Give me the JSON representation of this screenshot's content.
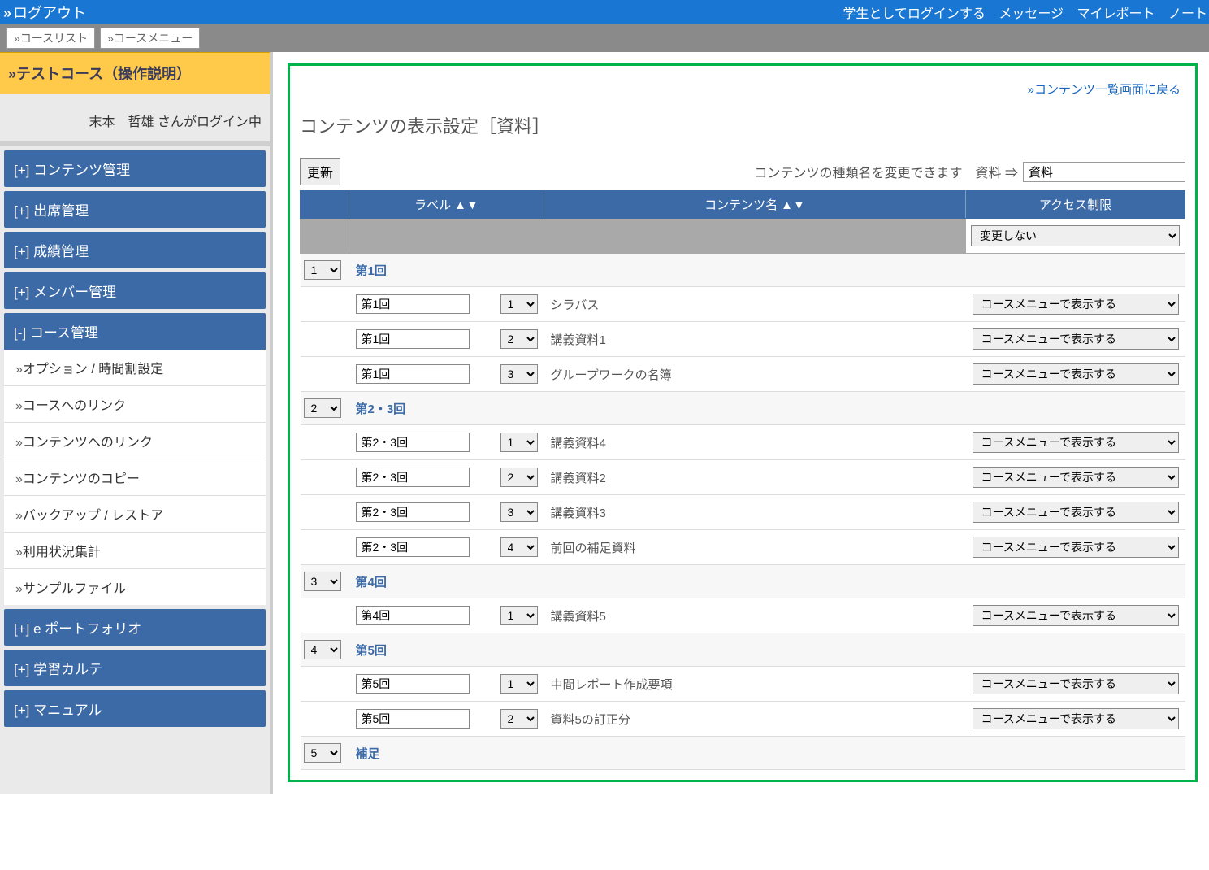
{
  "topbar": {
    "logout": "ログアウト",
    "login_as_student": "学生としてログインする",
    "messages": "メッセージ",
    "my_report": "マイレポート",
    "note": "ノート"
  },
  "breadcrumb": {
    "course_list": "コースリスト",
    "course_menu": "コースメニュー"
  },
  "sidebar": {
    "course_title": "テストコース（操作説明）",
    "login_status": "末本　哲雄 さんがログイン中",
    "menus": {
      "content_admin": "[+] コンテンツ管理",
      "attendance_admin": "[+] 出席管理",
      "grade_admin": "[+] 成績管理",
      "member_admin": "[+] メンバー管理",
      "course_admin": "[-] コース管理",
      "eportfolio": "[+] e ポートフォリオ",
      "study_karte": "[+] 学習カルテ",
      "manual": "[+] マニュアル"
    },
    "course_items": [
      "オプション / 時間割設定",
      "コースへのリンク",
      "コンテンツへのリンク",
      "コンテンツのコピー",
      "バックアップ / レストア",
      "利用状況集計",
      "サンプルファイル"
    ]
  },
  "main": {
    "back_link": "コンテンツ一覧画面に戻る",
    "page_title": "コンテンツの表示設定［資料］",
    "update_button": "更新",
    "rename_label": "コンテンツの種類名を変更できます　資料 ⇒",
    "rename_value": "資料",
    "headers": {
      "label": "ラベル",
      "content_name": "コンテンツ名",
      "access": "アクセス制限",
      "sort": "▲▼"
    },
    "filter_access": "変更しない",
    "access_option": "コースメニューで表示する",
    "groups": [
      {
        "order": "1",
        "title": "第1回",
        "items": [
          {
            "label": "第1回",
            "sub": "1",
            "name": "シラバス"
          },
          {
            "label": "第1回",
            "sub": "2",
            "name": "講義資料1"
          },
          {
            "label": "第1回",
            "sub": "3",
            "name": "グループワークの名簿"
          }
        ]
      },
      {
        "order": "2",
        "title": "第2・3回",
        "items": [
          {
            "label": "第2・3回",
            "sub": "1",
            "name": "講義資料4"
          },
          {
            "label": "第2・3回",
            "sub": "2",
            "name": "講義資料2"
          },
          {
            "label": "第2・3回",
            "sub": "3",
            "name": "講義資料3"
          },
          {
            "label": "第2・3回",
            "sub": "4",
            "name": "前回の補足資料"
          }
        ]
      },
      {
        "order": "3",
        "title": "第4回",
        "items": [
          {
            "label": "第4回",
            "sub": "1",
            "name": "講義資料5"
          }
        ]
      },
      {
        "order": "4",
        "title": "第5回",
        "items": [
          {
            "label": "第5回",
            "sub": "1",
            "name": "中間レポート作成要項"
          },
          {
            "label": "第5回",
            "sub": "2",
            "name": "資料5の訂正分"
          }
        ]
      },
      {
        "order": "5",
        "title": "補足",
        "items": []
      }
    ]
  }
}
